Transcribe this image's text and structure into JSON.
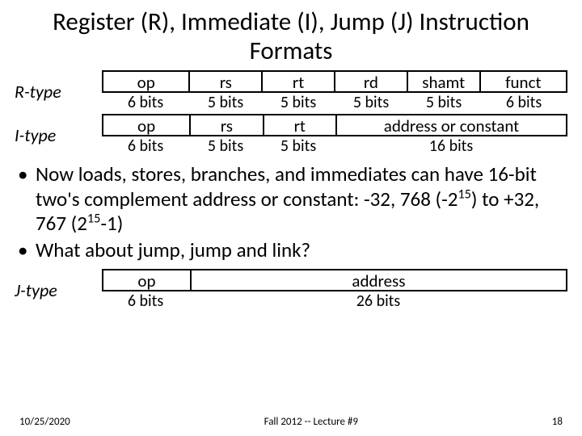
{
  "title": "Register (R), Immediate (I), Jump (J) Instruction Formats",
  "r": {
    "label": "R-type",
    "fields": [
      "op",
      "rs",
      "rt",
      "rd",
      "shamt",
      "funct"
    ],
    "bits": [
      "6 bits",
      "5 bits",
      "5 bits",
      "5 bits",
      "5 bits",
      "6 bits"
    ]
  },
  "i": {
    "label": "I-type",
    "fields": [
      "op",
      "rs",
      "rt",
      "address or constant"
    ],
    "bits": [
      "6 bits",
      "5 bits",
      "5 bits",
      "16 bits"
    ]
  },
  "j": {
    "label": "J-type",
    "fields": [
      "op",
      "address"
    ],
    "bits": [
      "6 bits",
      "26 bits"
    ]
  },
  "bullet1_parts": {
    "a": "Now loads, stores, branches, and immediates can have 16-bit two's complement address or constant: -32, 768 (-2",
    "b": ") to +32, 767 (2",
    "c": "-1)",
    "s1": "15",
    "s2": "15"
  },
  "bullet2": "What about jump, jump and link?",
  "footer": {
    "date": "10/25/2020",
    "center": "Fall 2012 -- Lecture #9",
    "page": "18"
  }
}
